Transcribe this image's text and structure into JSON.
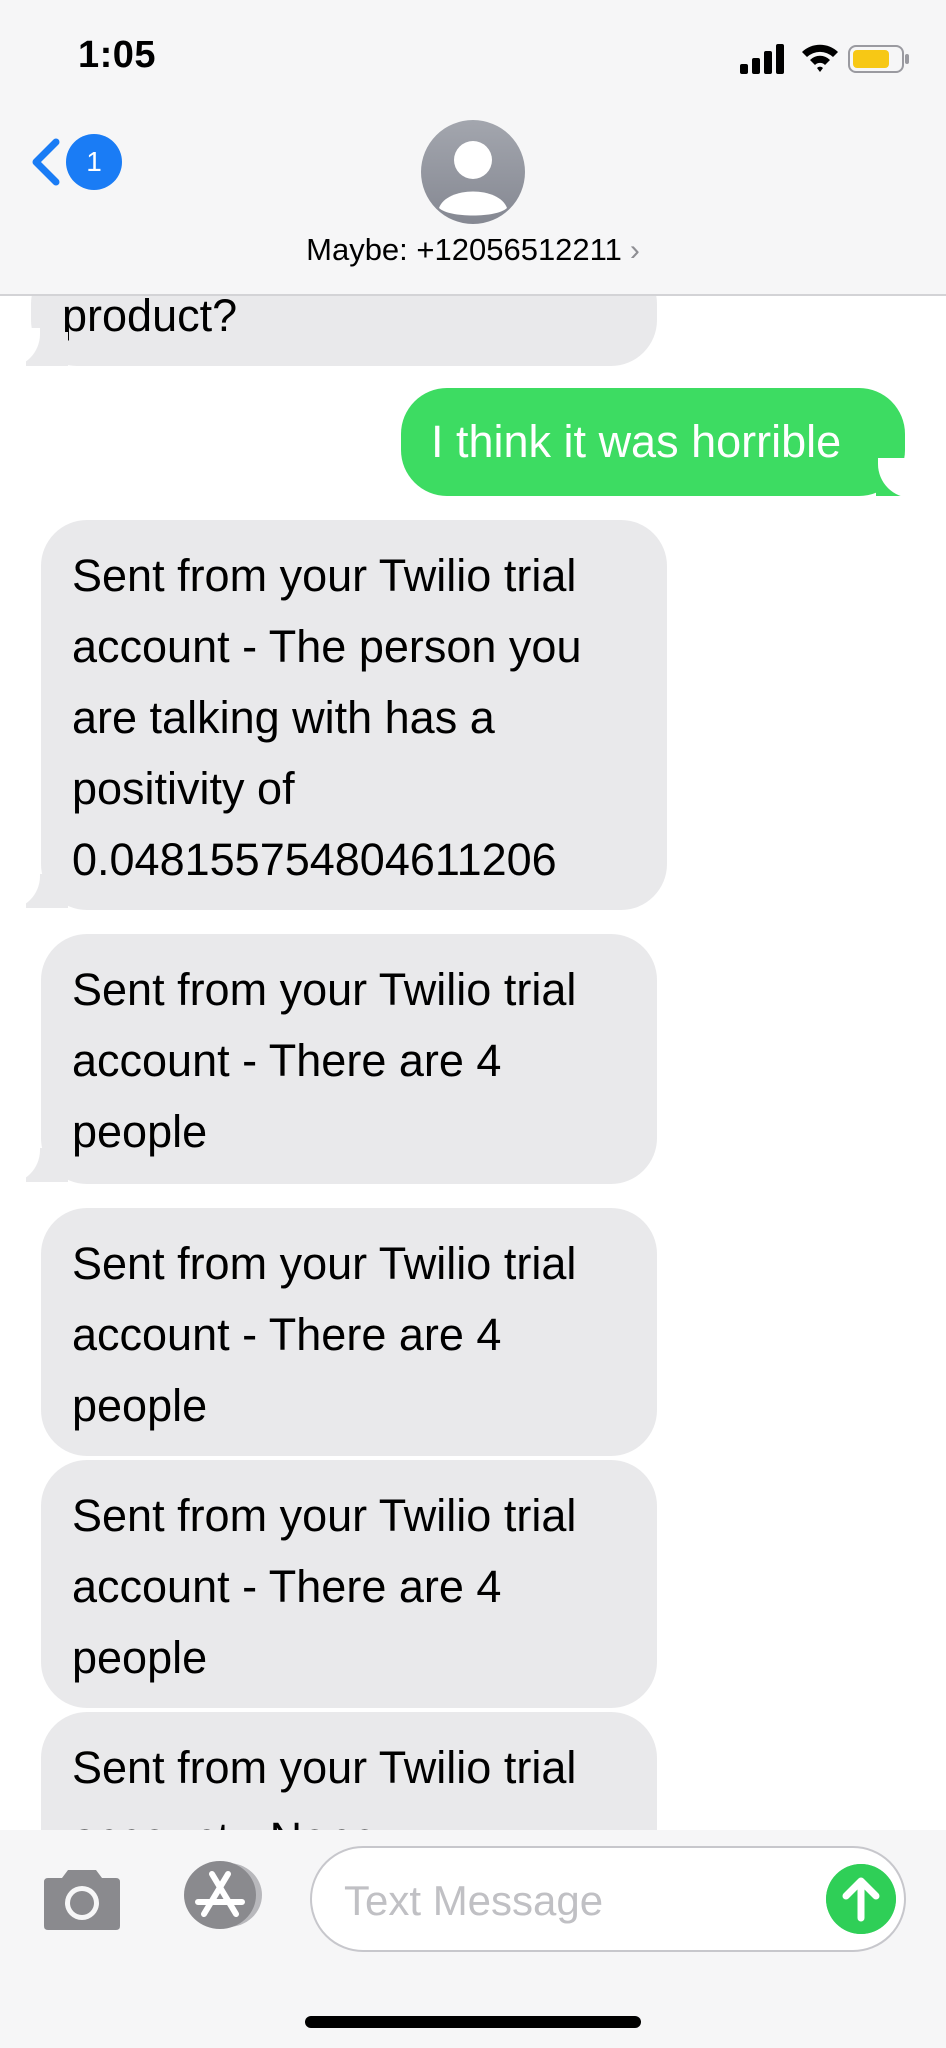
{
  "status_bar": {
    "time": "1:05",
    "signal_icon": "cellular-signal-icon",
    "wifi_icon": "wifi-icon",
    "battery_icon": "battery-icon",
    "battery_color": "#f7c815"
  },
  "header": {
    "back_badge_count": "1",
    "avatar_icon": "person-avatar-icon",
    "contact_name": "Maybe: +12056512211",
    "contact_chevron": "›"
  },
  "messages": [
    {
      "direction": "incoming",
      "text": "product?"
    },
    {
      "direction": "outgoing",
      "text": "I think it was horrible"
    },
    {
      "direction": "incoming",
      "lines": [
        "Sent from your Twilio trial",
        "account - The person you",
        "are talking with has a",
        "positivity of",
        "0.04815575480461120​6"
      ]
    },
    {
      "direction": "incoming",
      "lines": [
        "Sent from your Twilio trial",
        "account - There are 4",
        "people"
      ]
    },
    {
      "direction": "incoming",
      "lines": [
        "Sent from your Twilio trial",
        "account - There are 4",
        "people"
      ]
    },
    {
      "direction": "incoming",
      "lines": [
        "Sent from your Twilio trial",
        "account - There are 4",
        "people"
      ]
    },
    {
      "direction": "incoming",
      "lines": [
        "Sent from your Twilio trial",
        "account - None"
      ]
    }
  ],
  "input_bar": {
    "camera_icon": "camera-icon",
    "appstore_icon": "app-store-icon",
    "placeholder": "Text Message",
    "send_icon": "send-arrow-icon"
  },
  "colors": {
    "incoming_bubble": "#e9e9eb",
    "outgoing_bubble": "#3ddc62",
    "accent_blue": "#1a7cf5"
  }
}
